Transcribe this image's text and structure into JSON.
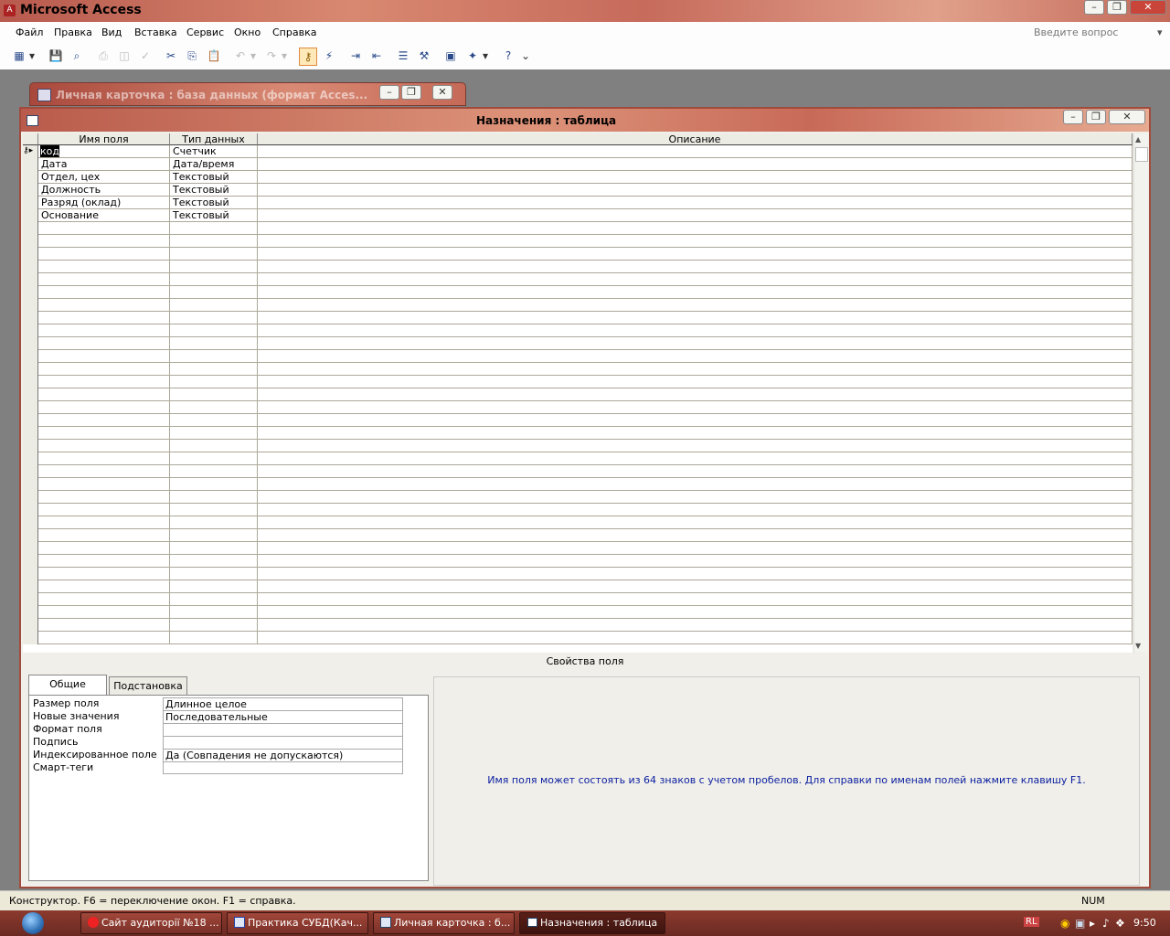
{
  "app": {
    "title": "Microsoft Access"
  },
  "menu": [
    "Файл",
    "Правка",
    "Вид",
    "Вставка",
    "Сервис",
    "Окно",
    "Справка"
  ],
  "help_box_placeholder": "Введите вопрос",
  "db_window": {
    "title": "Личная карточка : база данных (формат Acces..."
  },
  "table_window": {
    "title": "Назначения : таблица"
  },
  "grid": {
    "headers": [
      "Имя поля",
      "Тип данных",
      "Описание"
    ],
    "rows": [
      {
        "name": "код",
        "type": "Счетчик",
        "desc": ""
      },
      {
        "name": "Дата",
        "type": "Дата/время",
        "desc": ""
      },
      {
        "name": "Отдел, цех",
        "type": "Текстовый",
        "desc": ""
      },
      {
        "name": "Должность",
        "type": "Текстовый",
        "desc": ""
      },
      {
        "name": "Разряд (оклад)",
        "type": "Текстовый",
        "desc": ""
      },
      {
        "name": "Основание",
        "type": "Текстовый",
        "desc": ""
      }
    ]
  },
  "field_props": {
    "label": "Свойства поля",
    "tabs": [
      "Общие",
      "Подстановка"
    ],
    "rows": [
      {
        "name": "Размер поля",
        "value": "Длинное целое"
      },
      {
        "name": "Новые значения",
        "value": "Последовательные"
      },
      {
        "name": "Формат поля",
        "value": ""
      },
      {
        "name": "Подпись",
        "value": ""
      },
      {
        "name": "Индексированное поле",
        "value": "Да (Совпадения не допускаются)"
      },
      {
        "name": "Смарт-теги",
        "value": ""
      }
    ],
    "help": "Имя поля может состоять из 64 знаков с учетом пробелов.  Для справки по именам полей нажмите клавишу F1."
  },
  "status": {
    "text": "Конструктор.  F6 = переключение окон.  F1 = справка.",
    "num": "NUM"
  },
  "taskbar": {
    "items": [
      "Сайт аудиторії №18 ...",
      "Практика СУБД(Кач...",
      "Личная карточка : б...",
      "Назначения : таблица"
    ],
    "lang": "RL",
    "clock": "9:50"
  }
}
